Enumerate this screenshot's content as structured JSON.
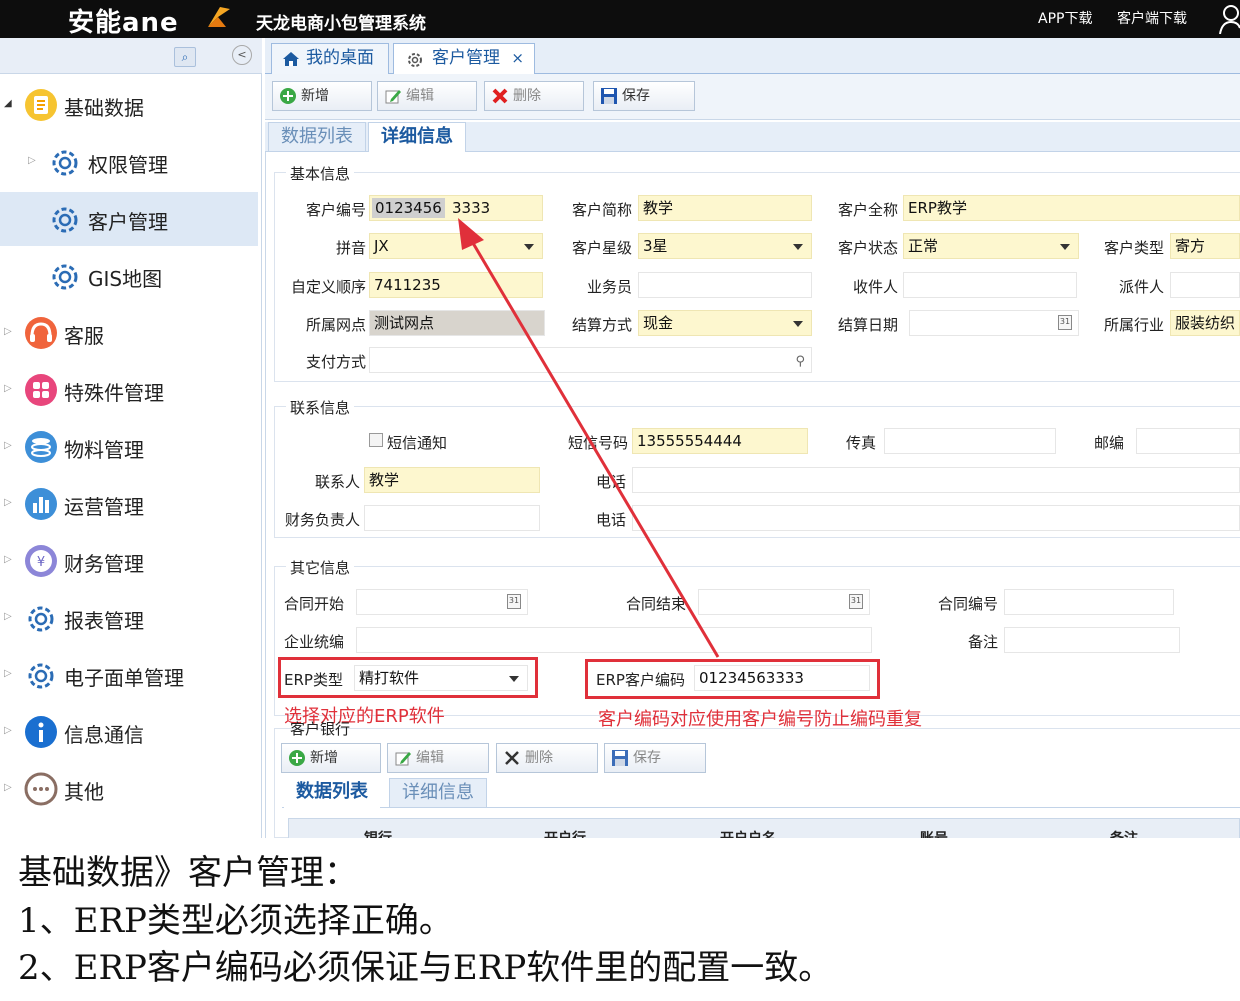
{
  "topbar": {
    "logo": "安能ane",
    "system_title": "天龙电商小包管理系统",
    "app_download": "APP下载",
    "client_download": "客户端下载"
  },
  "sidebar": {
    "items": [
      {
        "label": "基础数据",
        "icon": "document-icon"
      },
      {
        "label": "权限管理",
        "icon": "gear-icon"
      },
      {
        "label": "客户管理",
        "icon": "gear-icon"
      },
      {
        "label": "GIS地图",
        "icon": "gear-icon"
      },
      {
        "label": "客服",
        "icon": "headset-icon"
      },
      {
        "label": "特殊件管理",
        "icon": "grid-icon"
      },
      {
        "label": "物料管理",
        "icon": "stack-icon"
      },
      {
        "label": "运营管理",
        "icon": "bar-chart-icon"
      },
      {
        "label": "财务管理",
        "icon": "yen-icon"
      },
      {
        "label": "报表管理",
        "icon": "gear-icon"
      },
      {
        "label": "电子面单管理",
        "icon": "gear-icon"
      },
      {
        "label": "信息通信",
        "icon": "info-icon"
      },
      {
        "label": "其他",
        "icon": "more-icon"
      }
    ]
  },
  "tabs": {
    "desktop": "我的桌面",
    "customer": "客户管理",
    "close": "×"
  },
  "toolbar": {
    "add": "新增",
    "edit": "编辑",
    "delete": "删除",
    "save": "保存"
  },
  "subtabs": {
    "list": "数据列表",
    "detail": "详细信息"
  },
  "basic": {
    "title": "基本信息",
    "customer_no_label": "客户编号",
    "customer_no_prefix": "0123456",
    "customer_no_suffix": "3333",
    "short_name_label": "客户简称",
    "short_name": "教学",
    "full_name_label": "客户全称",
    "full_name": "ERP教学",
    "pinyin_label": "拼音",
    "pinyin": "JX",
    "star_label": "客户星级",
    "star": "3星",
    "status_label": "客户状态",
    "status": "正常",
    "type_label": "客户类型",
    "type": "寄方",
    "order_label": "自定义顺序",
    "order": "7411235",
    "salesman_label": "业务员",
    "receiver_label": "收件人",
    "dispatcher_label": "派件人",
    "site_label": "所属网点",
    "site": "测试网点",
    "settle_label": "结算方式",
    "settle": "现金",
    "settle_date_label": "结算日期",
    "industry_label": "所属行业",
    "industry": "服装纺织",
    "pay_label": "支付方式"
  },
  "contact": {
    "title": "联系信息",
    "sms_label": "短信通知",
    "sms_no_label": "短信号码",
    "sms_no": "13555554444",
    "fax_label": "传真",
    "zip_label": "邮编",
    "contact_label": "联系人",
    "contact": "教学",
    "phone_label": "电话",
    "finance_label": "财务负责人",
    "phone2_label": "电话"
  },
  "other": {
    "title": "其它信息",
    "contract_start_label": "合同开始",
    "contract_end_label": "合同结束",
    "contract_no_label": "合同编号",
    "enterprise_label": "企业统编",
    "remark_label": "备注",
    "erp_type_label": "ERP类型",
    "erp_type": "精打软件",
    "erp_code_label": "ERP客户编码",
    "erp_code": "01234563333"
  },
  "annotations": {
    "erp_type_note": "选择对应的ERP软件",
    "erp_code_note": "客户编码对应使用客户编号防止编码重复"
  },
  "bank": {
    "title": "客户银行",
    "add": "新增",
    "edit": "编辑",
    "delete": "删除",
    "save": "保存",
    "list_tab": "数据列表",
    "detail_tab": "详细信息",
    "columns": [
      "银行",
      "开户行",
      "开户户名",
      "账号",
      "备注"
    ]
  },
  "notes": {
    "line1": "基础数据》客户管理：",
    "line2": "1、ERP类型必须选择正确。",
    "line3": "2、ERP客户编码必须保证与ERP软件里的配置一致。"
  },
  "colors": {
    "topbar": "#0d0d0d",
    "required_field": "#fdf7cf",
    "annotation_red": "#e0303a",
    "link_blue": "#1c5aa0"
  }
}
